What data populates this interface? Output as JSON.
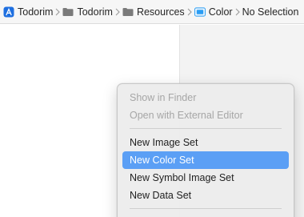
{
  "breadcrumb": {
    "items": [
      {
        "label": "Todorim",
        "icon": "app-project-icon"
      },
      {
        "label": "Todorim",
        "icon": "folder-icon"
      },
      {
        "label": "Resources",
        "icon": "folder-icon"
      },
      {
        "label": "Color",
        "icon": "asset-catalog-icon"
      },
      {
        "label": "No Selection",
        "icon": ""
      }
    ],
    "separator_icon": "chevron-right-icon"
  },
  "context_menu": {
    "group1": [
      {
        "label": "Show in Finder",
        "enabled": false
      },
      {
        "label": "Open with External Editor",
        "enabled": false
      }
    ],
    "group2": [
      {
        "label": "New Image Set",
        "enabled": true,
        "selected": false
      },
      {
        "label": "New Color Set",
        "enabled": true,
        "selected": true
      },
      {
        "label": "New Symbol Image Set",
        "enabled": true,
        "selected": false
      },
      {
        "label": "New Data Set",
        "enabled": true,
        "selected": false
      }
    ]
  },
  "colors": {
    "accent": "#5b9ff5",
    "project_icon": "#1e6fe0",
    "asset_icon": "#2a9df4"
  }
}
